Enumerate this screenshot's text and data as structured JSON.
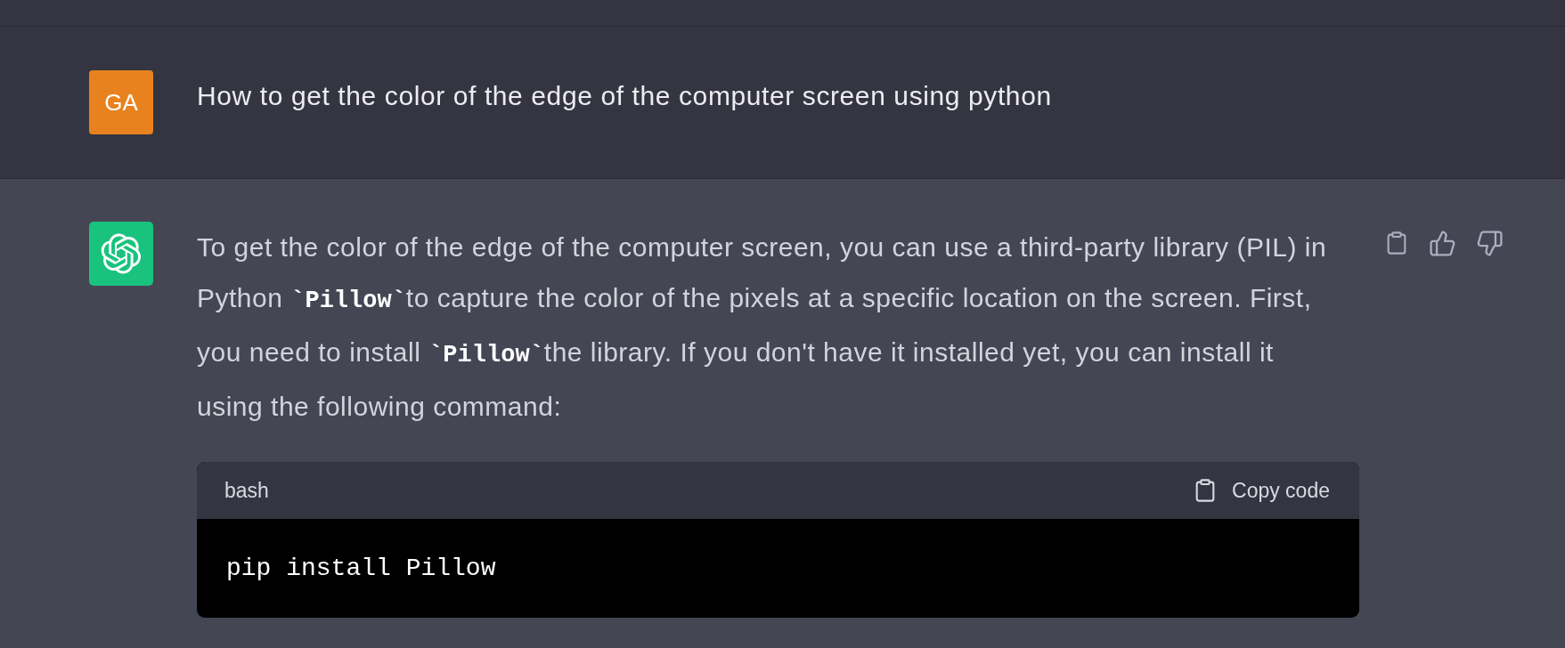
{
  "user_message": {
    "avatar": "GA",
    "text": "How to get the color of the edge of the computer screen using python"
  },
  "assistant_message": {
    "paragraph_lines": [
      [
        {
          "kind": "text",
          "text": "To get the color of the edge of the computer screen, you can use a third-party library (PIL) in"
        }
      ],
      [
        {
          "kind": "text",
          "text": "Python "
        },
        {
          "kind": "code",
          "text": "`Pillow`"
        },
        {
          "kind": "text",
          "text": "to capture the color of the pixels at a specific location on the screen. First,"
        }
      ],
      [
        {
          "kind": "text",
          "text": "you need to install "
        },
        {
          "kind": "code",
          "text": "`Pillow`"
        },
        {
          "kind": "text",
          "text": "the library. If you don't have it installed yet, you can install it"
        }
      ],
      [
        {
          "kind": "text",
          "text": "using the following command:"
        }
      ]
    ],
    "code_block": {
      "language": "bash",
      "copy_label": "Copy code",
      "code": "pip install Pillow"
    }
  }
}
